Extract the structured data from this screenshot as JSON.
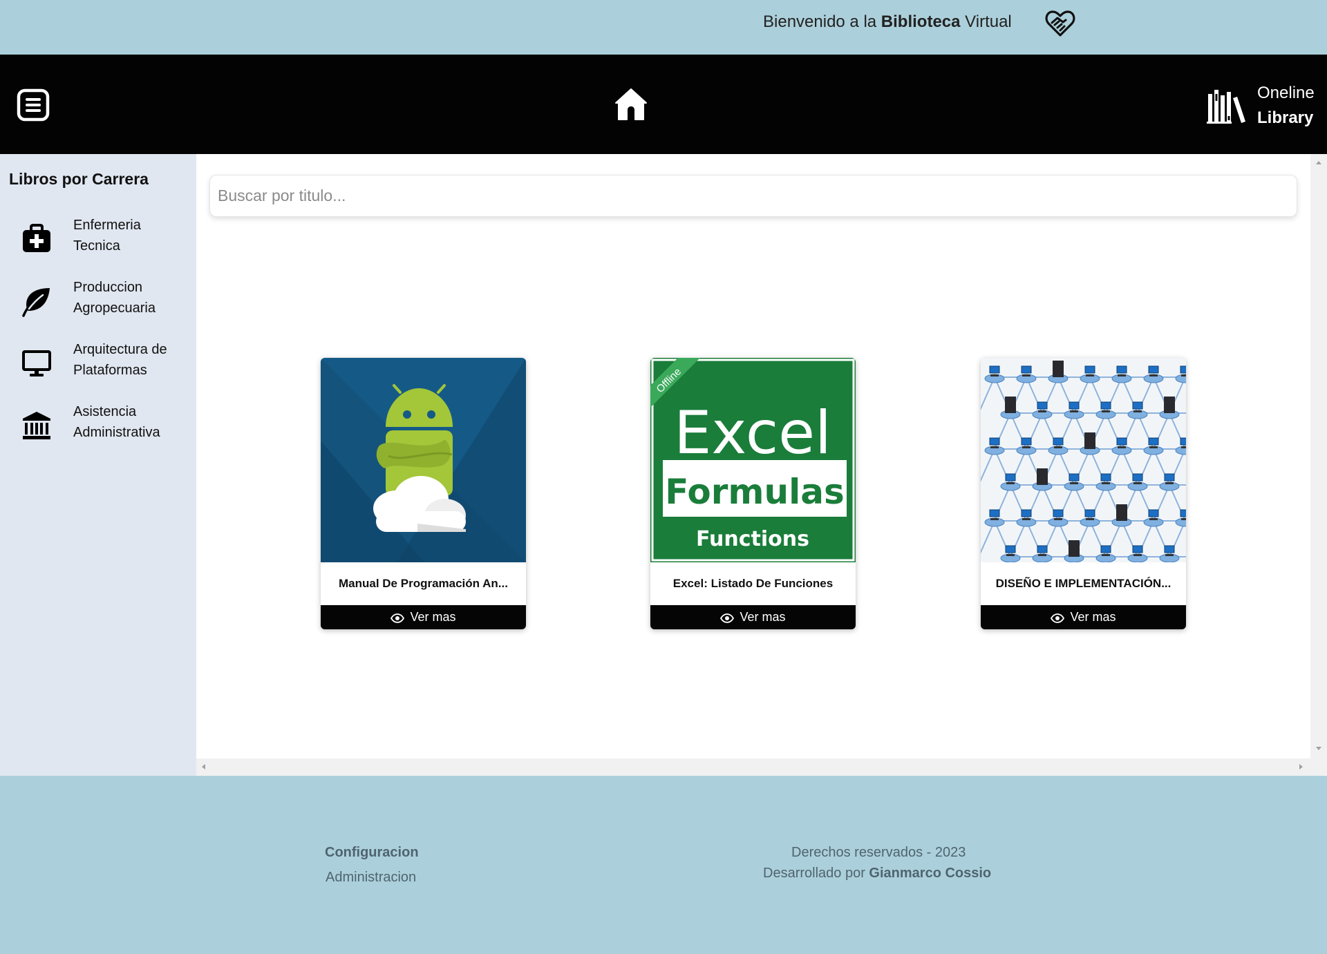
{
  "header": {
    "welcome_prefix": "Bienvenido a la",
    "welcome_bold": "Biblioteca",
    "welcome_suffix": "Virtual",
    "heart_icon": "heart-handshake-icon"
  },
  "navbar": {
    "menu_icon": "menu-list-icon",
    "home_icon": "home-icon",
    "brand_icon": "books-icon",
    "brand_line1": "Oneline",
    "brand_line2": "Library"
  },
  "sidebar": {
    "title": "Libros por Carrera",
    "items": [
      {
        "line1": "Enfermeria",
        "line2": "Tecnica",
        "icon": "medical-kit-icon"
      },
      {
        "line1": "Produccion",
        "line2": "Agropecuaria",
        "icon": "leaf-icon"
      },
      {
        "line1": "Arquitectura de",
        "line2": "Plataformas",
        "icon": "monitor-icon"
      },
      {
        "line1": "Asistencia",
        "line2": "Administrativa",
        "icon": "institution-icon"
      }
    ]
  },
  "search": {
    "placeholder": "Buscar por titulo...",
    "value": ""
  },
  "books": [
    {
      "title": "Manual De Programación An...",
      "button": "Ver mas",
      "cover": "android-cover"
    },
    {
      "title": "Excel: Listado De Funciones",
      "button": "Ver mas",
      "cover": "excel-cover",
      "cover_text": {
        "ribbon": "Offline",
        "big": "Excel",
        "box": "Formulas",
        "sub": "Functions"
      }
    },
    {
      "title": "DISEÑO E IMPLEMENTACIÓN...",
      "button": "Ver mas",
      "cover": "network-cover"
    }
  ],
  "footer": {
    "config": "Configuracion",
    "admin": "Administracion",
    "rights": "Derechos reservados - 2023",
    "dev_prefix": "Desarrollado por",
    "dev_name": "Gianmarco Cossio"
  },
  "colors": {
    "top_bar": "#acd0db",
    "nav_bar": "#030303",
    "sidebar": "#e1e7f0",
    "footer_text": "#4e6470",
    "excel_green": "#1a7d3a",
    "android_bg": "#155a86"
  }
}
